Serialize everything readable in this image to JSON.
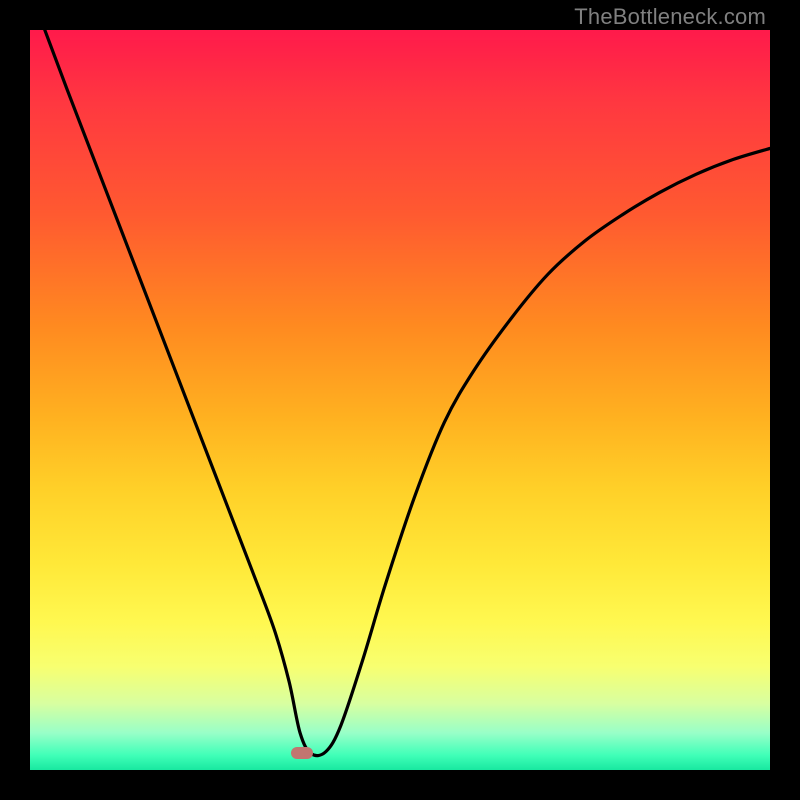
{
  "watermark": "TheBottleneck.com",
  "chart_data": {
    "type": "line",
    "title": "",
    "xlabel": "",
    "ylabel": "",
    "xlim": [
      0,
      100
    ],
    "ylim": [
      0,
      100
    ],
    "series": [
      {
        "name": "curve",
        "x": [
          2,
          5,
          10,
          15,
          20,
          25,
          30,
          33,
          35,
          36.5,
          38,
          40,
          42,
          45,
          48,
          52,
          56,
          60,
          65,
          70,
          75,
          80,
          85,
          90,
          95,
          100
        ],
        "y": [
          100,
          92,
          79,
          66,
          53,
          40,
          27,
          19,
          12,
          5,
          2.2,
          2.5,
          6,
          15,
          25,
          37,
          47,
          54,
          61,
          67,
          71.5,
          75,
          78,
          80.5,
          82.5,
          84
        ]
      }
    ],
    "marker": {
      "x": 36.8,
      "y": 2.3,
      "color": "#c27570"
    },
    "gradient_stops": [
      {
        "pct": 0,
        "color": "#ff1a4b"
      },
      {
        "pct": 25,
        "color": "#ff5a30"
      },
      {
        "pct": 55,
        "color": "#ffc028"
      },
      {
        "pct": 80,
        "color": "#fff850"
      },
      {
        "pct": 100,
        "color": "#18e8a0"
      }
    ]
  }
}
